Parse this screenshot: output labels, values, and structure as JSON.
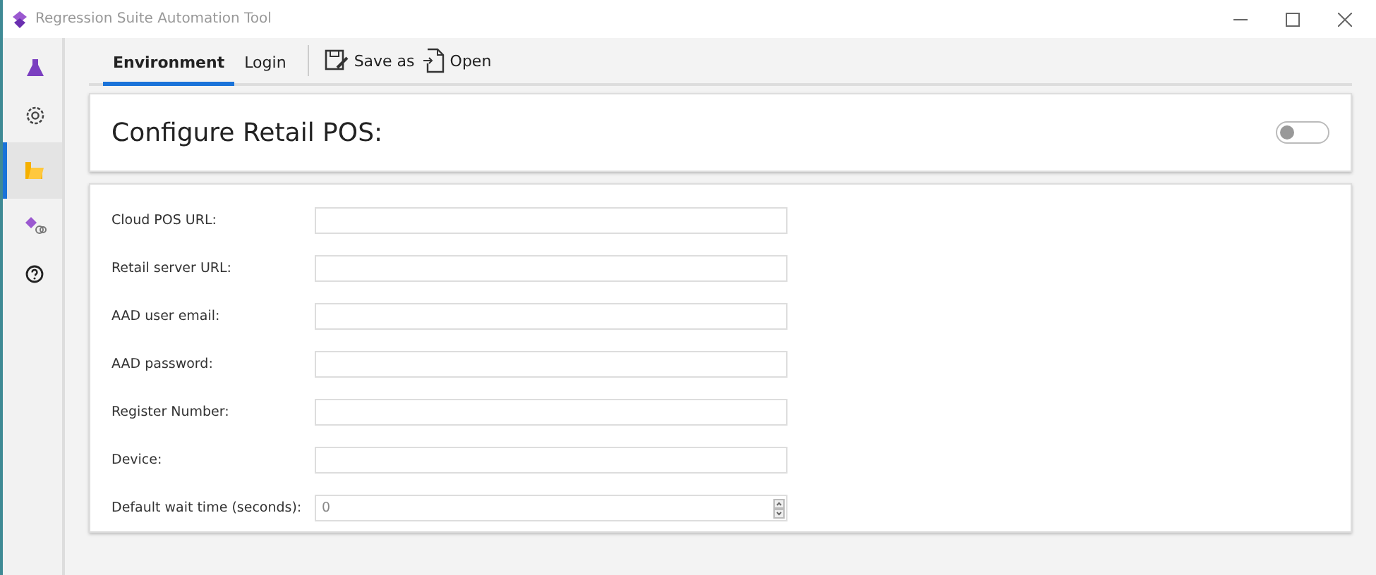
{
  "window": {
    "title": "Regression Suite Automation Tool"
  },
  "sidebar": {
    "items": [
      {
        "kind": "flask",
        "selected": false
      },
      {
        "kind": "gear",
        "selected": false
      },
      {
        "kind": "folder",
        "selected": true
      },
      {
        "kind": "tags",
        "selected": false
      },
      {
        "kind": "help",
        "selected": false
      }
    ]
  },
  "tabs": [
    {
      "label": "Environment",
      "selected": true
    },
    {
      "label": "Login",
      "selected": false
    }
  ],
  "toolbar": [
    {
      "kind": "save",
      "label": "Save as"
    },
    {
      "kind": "open",
      "label": "Open"
    }
  ],
  "header": {
    "title": "Configure Retail POS:",
    "toggle": {
      "on": false
    }
  },
  "fields": [
    {
      "kind": "text",
      "label": "Cloud POS URL:"
    },
    {
      "kind": "text",
      "label": "Retail server URL:"
    },
    {
      "kind": "text",
      "label": "AAD user email:"
    },
    {
      "kind": "text",
      "label": "AAD password:"
    },
    {
      "kind": "text",
      "label": "Register Number:"
    },
    {
      "kind": "text",
      "label": "Device:"
    },
    {
      "kind": "number",
      "label": "Default wait time (seconds):",
      "value": "0"
    }
  ]
}
